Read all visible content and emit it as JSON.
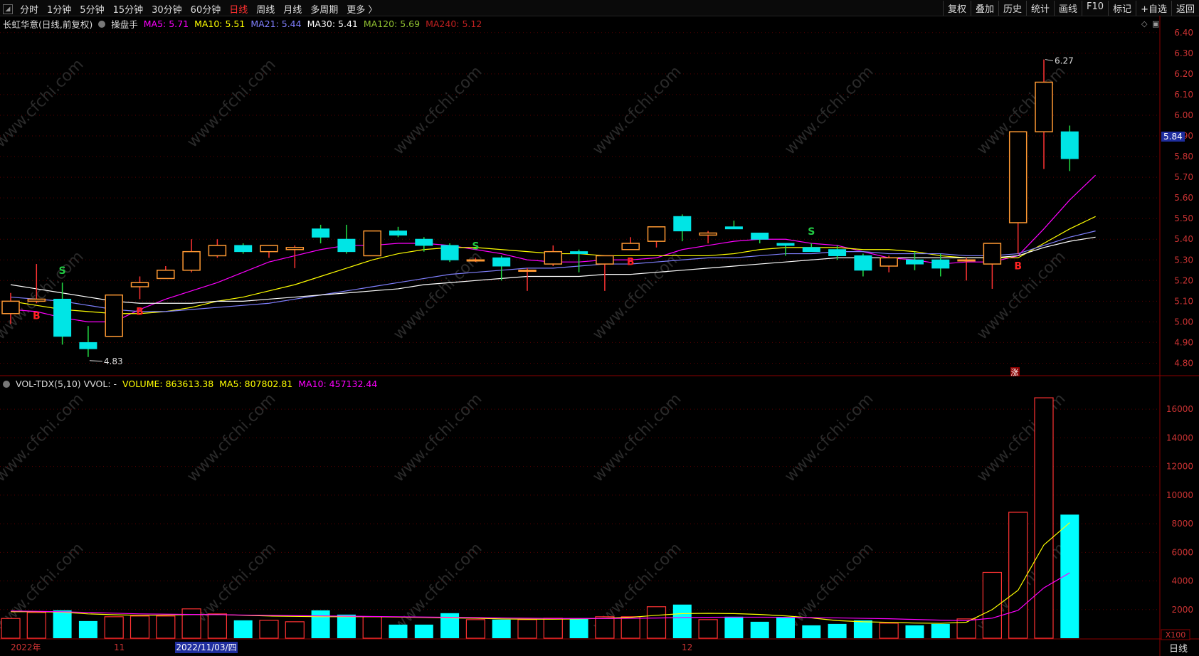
{
  "toolbar": {
    "periods": [
      "分时",
      "1分钟",
      "5分钟",
      "15分钟",
      "30分钟",
      "60分钟",
      "日线",
      "周线",
      "月线",
      "多周期",
      "更多 〉"
    ],
    "active_period": "日线",
    "right_buttons": [
      "复权",
      "叠加",
      "历史",
      "统计",
      "画线",
      "F10",
      "+自选",
      "返回"
    ],
    "right_buttons2": [
      "标记"
    ]
  },
  "main_legend": {
    "title": "长虹华意(日线,前复权)",
    "indicator": "操盘手",
    "ma5": "MA5: 5.71",
    "ma10": "MA10: 5.51",
    "ma21": "MA21: 5.44",
    "ma30": "MA30: 5.41",
    "ma120": "MA120: 5.69",
    "ma240": "MA240: 5.12"
  },
  "vol_legend": {
    "title": "VOL-TDX(5,10) VVOL: -",
    "volume": "VOLUME: 863613.38",
    "ma5": "MA5: 807802.81",
    "ma10": "MA10: 457132.44"
  },
  "price_axis": [
    "6.40",
    "6.30",
    "6.20",
    "6.10",
    "6.00",
    "5.90",
    "5.80",
    "5.70",
    "5.60",
    "5.50",
    "5.40",
    "5.30",
    "5.20",
    "5.10",
    "5.00",
    "4.90",
    "4.80"
  ],
  "current_price_tag": "5.84",
  "high_label": "6.27",
  "low_label": "4.83",
  "vol_axis": [
    "16000",
    "14000",
    "12000",
    "10000",
    "8000",
    "6000",
    "4000",
    "2000"
  ],
  "vol_unit": "X100",
  "date_labels": {
    "year": "2022年",
    "nov": "11",
    "cursor": "2022/11/03/四",
    "dec": "12"
  },
  "period_label": "日线",
  "zhang_marker": "涨",
  "watermark": "www.cfchi.com",
  "signals": [
    {
      "text": "S",
      "idx": 2,
      "color": "#22cc44"
    },
    {
      "text": "B",
      "idx": 1,
      "color": "#ff2222"
    },
    {
      "text": "B",
      "idx": 5,
      "color": "#ff2222"
    },
    {
      "text": "S",
      "idx": 18,
      "color": "#22cc44"
    },
    {
      "text": "B",
      "idx": 24,
      "color": "#ff2222"
    },
    {
      "text": "S",
      "idx": 31,
      "color": "#22cc44"
    },
    {
      "text": "B",
      "idx": 39,
      "color": "#ff2222"
    }
  ],
  "chart_data": {
    "type": "candlestick",
    "ylim": [
      4.75,
      6.42
    ],
    "candles": [
      {
        "o": 5.04,
        "h": 5.14,
        "l": 4.99,
        "c": 5.1
      },
      {
        "o": 5.1,
        "h": 5.28,
        "l": 5.09,
        "c": 5.11
      },
      {
        "o": 5.11,
        "h": 5.19,
        "l": 4.89,
        "c": 4.93
      },
      {
        "o": 4.9,
        "h": 4.98,
        "l": 4.83,
        "c": 4.87
      },
      {
        "o": 4.93,
        "h": 5.13,
        "l": 4.93,
        "c": 5.13
      },
      {
        "o": 5.17,
        "h": 5.22,
        "l": 5.11,
        "c": 5.19
      },
      {
        "o": 5.21,
        "h": 5.27,
        "l": 5.21,
        "c": 5.25
      },
      {
        "o": 5.25,
        "h": 5.4,
        "l": 5.24,
        "c": 5.34
      },
      {
        "o": 5.32,
        "h": 5.4,
        "l": 5.31,
        "c": 5.37
      },
      {
        "o": 5.37,
        "h": 5.38,
        "l": 5.33,
        "c": 5.34
      },
      {
        "o": 5.34,
        "h": 5.37,
        "l": 5.31,
        "c": 5.37
      },
      {
        "o": 5.35,
        "h": 5.37,
        "l": 5.26,
        "c": 5.36
      },
      {
        "o": 5.45,
        "h": 5.47,
        "l": 5.38,
        "c": 5.41
      },
      {
        "o": 5.4,
        "h": 5.47,
        "l": 5.33,
        "c": 5.34
      },
      {
        "o": 5.32,
        "h": 5.44,
        "l": 5.32,
        "c": 5.44
      },
      {
        "o": 5.44,
        "h": 5.46,
        "l": 5.41,
        "c": 5.42
      },
      {
        "o": 5.4,
        "h": 5.41,
        "l": 5.34,
        "c": 5.37
      },
      {
        "o": 5.37,
        "h": 5.38,
        "l": 5.29,
        "c": 5.3
      },
      {
        "o": 5.3,
        "h": 5.31,
        "l": 5.29,
        "c": 5.3
      },
      {
        "o": 5.31,
        "h": 5.32,
        "l": 5.2,
        "c": 5.27
      },
      {
        "o": 5.25,
        "h": 5.26,
        "l": 5.15,
        "c": 5.25
      },
      {
        "o": 5.28,
        "h": 5.37,
        "l": 5.27,
        "c": 5.34
      },
      {
        "o": 5.34,
        "h": 5.35,
        "l": 5.24,
        "c": 5.33
      },
      {
        "o": 5.28,
        "h": 5.32,
        "l": 5.15,
        "c": 5.32
      },
      {
        "o": 5.35,
        "h": 5.41,
        "l": 5.35,
        "c": 5.38
      },
      {
        "o": 5.39,
        "h": 5.45,
        "l": 5.36,
        "c": 5.46
      },
      {
        "o": 5.51,
        "h": 5.52,
        "l": 5.39,
        "c": 5.44
      },
      {
        "o": 5.42,
        "h": 5.44,
        "l": 5.38,
        "c": 5.43
      },
      {
        "o": 5.46,
        "h": 5.49,
        "l": 5.45,
        "c": 5.45
      },
      {
        "o": 5.43,
        "h": 5.43,
        "l": 5.38,
        "c": 5.4
      },
      {
        "o": 5.38,
        "h": 5.38,
        "l": 5.32,
        "c": 5.37
      },
      {
        "o": 5.36,
        "h": 5.38,
        "l": 5.34,
        "c": 5.34
      },
      {
        "o": 5.35,
        "h": 5.37,
        "l": 5.3,
        "c": 5.32
      },
      {
        "o": 5.32,
        "h": 5.33,
        "l": 5.22,
        "c": 5.25
      },
      {
        "o": 5.27,
        "h": 5.32,
        "l": 5.24,
        "c": 5.31
      },
      {
        "o": 5.3,
        "h": 5.34,
        "l": 5.25,
        "c": 5.28
      },
      {
        "o": 5.3,
        "h": 5.33,
        "l": 5.22,
        "c": 5.26
      },
      {
        "o": 5.3,
        "h": 5.31,
        "l": 5.2,
        "c": 5.3
      },
      {
        "o": 5.28,
        "h": 5.38,
        "l": 5.16,
        "c": 5.38
      },
      {
        "o": 5.48,
        "h": 5.92,
        "l": 5.33,
        "c": 5.92
      },
      {
        "o": 5.92,
        "h": 6.27,
        "l": 5.74,
        "c": 6.16
      },
      {
        "o": 5.92,
        "h": 5.95,
        "l": 5.73,
        "c": 5.79
      }
    ],
    "ma_lines": [
      {
        "name": "MA5",
        "color": "#ff00ff",
        "values": [
          5.06,
          5.05,
          5.02,
          5.0,
          5.0,
          5.06,
          5.11,
          5.15,
          5.19,
          5.24,
          5.29,
          5.32,
          5.35,
          5.37,
          5.37,
          5.38,
          5.38,
          5.37,
          5.35,
          5.33,
          5.3,
          5.29,
          5.29,
          5.3,
          5.3,
          5.31,
          5.35,
          5.37,
          5.39,
          5.4,
          5.4,
          5.38,
          5.37,
          5.34,
          5.31,
          5.3,
          5.28,
          5.29,
          5.29,
          5.32,
          5.45,
          5.59,
          5.71
        ]
      },
      {
        "name": "MA10",
        "color": "#ffff00",
        "values": [
          5.1,
          5.08,
          5.06,
          5.05,
          5.04,
          5.04,
          5.05,
          5.07,
          5.1,
          5.12,
          5.15,
          5.18,
          5.22,
          5.26,
          5.3,
          5.33,
          5.35,
          5.36,
          5.36,
          5.35,
          5.34,
          5.33,
          5.33,
          5.32,
          5.32,
          5.32,
          5.32,
          5.32,
          5.33,
          5.35,
          5.36,
          5.36,
          5.36,
          5.35,
          5.35,
          5.34,
          5.32,
          5.31,
          5.31,
          5.31,
          5.38,
          5.45,
          5.51
        ]
      },
      {
        "name": "MA21",
        "color": "#8080ff",
        "values": [
          5.12,
          5.11,
          5.1,
          5.08,
          5.06,
          5.05,
          5.05,
          5.06,
          5.07,
          5.08,
          5.09,
          5.11,
          5.13,
          5.15,
          5.17,
          5.19,
          5.21,
          5.23,
          5.24,
          5.25,
          5.26,
          5.26,
          5.27,
          5.28,
          5.28,
          5.29,
          5.3,
          5.31,
          5.31,
          5.32,
          5.33,
          5.33,
          5.34,
          5.34,
          5.33,
          5.33,
          5.33,
          5.32,
          5.32,
          5.33,
          5.37,
          5.41,
          5.44
        ]
      },
      {
        "name": "MA30",
        "color": "#ffffff",
        "values": [
          5.18,
          5.16,
          5.14,
          5.12,
          5.1,
          5.09,
          5.09,
          5.09,
          5.1,
          5.1,
          5.11,
          5.12,
          5.13,
          5.14,
          5.15,
          5.16,
          5.18,
          5.19,
          5.2,
          5.21,
          5.22,
          5.22,
          5.22,
          5.23,
          5.23,
          5.24,
          5.25,
          5.26,
          5.27,
          5.28,
          5.29,
          5.3,
          5.31,
          5.31,
          5.31,
          5.31,
          5.31,
          5.31,
          5.31,
          5.32,
          5.36,
          5.39,
          5.41
        ]
      }
    ],
    "volumes": [
      1380,
      1800,
      1950,
      1200,
      1500,
      1550,
      1550,
      2050,
      1700,
      1250,
      1250,
      1150,
      1950,
      1650,
      1500,
      950,
      950,
      1750,
      1300,
      1300,
      1300,
      1400,
      1400,
      1500,
      1500,
      2200,
      2350,
      1300,
      1500,
      1150,
      1450,
      900,
      1000,
      1250,
      1050,
      900,
      1000,
      1350,
      4600,
      8800,
      16800,
      8636
    ],
    "vol_ma5": [
      1850,
      1850,
      1820,
      1700,
      1640,
      1600,
      1620,
      1650,
      1660,
      1600,
      1550,
      1530,
      1500,
      1500,
      1500,
      1480,
      1450,
      1420,
      1400,
      1350,
      1330,
      1330,
      1350,
      1400,
      1460,
      1600,
      1720,
      1740,
      1720,
      1660,
      1560,
      1420,
      1230,
      1150,
      1110,
      1060,
      1040,
      1120,
      2000,
      3350,
      6520,
      8078
    ],
    "vol_ma10": [
      1900,
      1880,
      1850,
      1800,
      1750,
      1700,
      1680,
      1660,
      1650,
      1620,
      1600,
      1580,
      1560,
      1540,
      1520,
      1500,
      1480,
      1460,
      1440,
      1420,
      1400,
      1380,
      1380,
      1380,
      1390,
      1410,
      1440,
      1460,
      1470,
      1470,
      1460,
      1440,
      1420,
      1390,
      1360,
      1310,
      1260,
      1230,
      1400,
      1950,
      3520,
      4571
    ],
    "vol_ylim": [
      0,
      17500
    ]
  }
}
